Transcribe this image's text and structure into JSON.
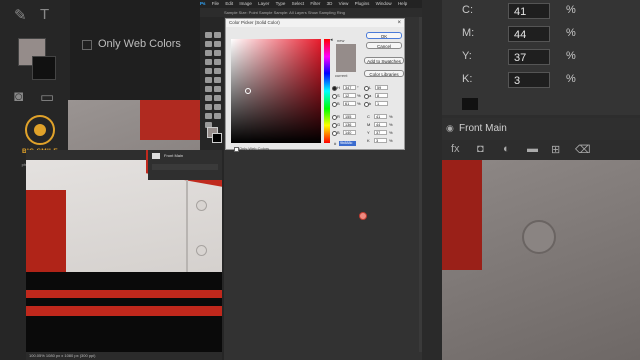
{
  "left_bg": {
    "only_web_colors": "Only Web Colors",
    "logo_name": "BIG SMILE EDITING",
    "logo_tagline": "photo editing service"
  },
  "ps": {
    "menu": [
      "File",
      "Edit",
      "Image",
      "Layer",
      "Type",
      "Select",
      "Filter",
      "3D",
      "View",
      "Plugins",
      "Window",
      "Help"
    ],
    "options_text": "Sample Size: Point Sample   Sample: All Layers   Show Sampling Ring",
    "status_text": "100.05%  1080 px x 1080 px (300 ppi)",
    "layer_name": "Front Main",
    "logo_text": "BIG SMILE EDITING"
  },
  "picker": {
    "title": "Color Picker (Solid Color)",
    "new_label": "new",
    "current_label": "current",
    "ok_label": "OK",
    "cancel_label": "Cancel",
    "add_swatches_label": "Add to Swatches",
    "color_libraries_label": "Color Libraries",
    "only_web_colors": "Only Web Colors",
    "hsb": [
      {
        "k": "H",
        "v": "347",
        "u": "°"
      },
      {
        "k": "S",
        "v": "12",
        "u": "%"
      },
      {
        "k": "B",
        "v": "61",
        "u": "%"
      }
    ],
    "rgb": [
      {
        "k": "R",
        "v": "155"
      },
      {
        "k": "G",
        "v": "136"
      },
      {
        "k": "B",
        "v": "140"
      }
    ],
    "lab": [
      {
        "k": "L",
        "v": "59"
      },
      {
        "k": "a",
        "v": "8"
      },
      {
        "k": "b",
        "v": "1"
      }
    ],
    "cmyk": [
      {
        "k": "C",
        "v": "41",
        "u": "%"
      },
      {
        "k": "M",
        "v": "44",
        "u": "%"
      },
      {
        "k": "Y",
        "v": "37",
        "u": "%"
      },
      {
        "k": "K",
        "v": "3",
        "u": "%"
      }
    ],
    "hex_label": "#",
    "hex": "9b888c",
    "color": "#958c8a"
  },
  "right_bg": {
    "cmyk": [
      {
        "k": "C:",
        "v": "41",
        "u": "%"
      },
      {
        "k": "M:",
        "v": "44",
        "u": "%"
      },
      {
        "k": "Y:",
        "v": "37",
        "u": "%"
      },
      {
        "k": "K:",
        "v": "3",
        "u": "%"
      }
    ],
    "layer_name": "Front Main"
  }
}
